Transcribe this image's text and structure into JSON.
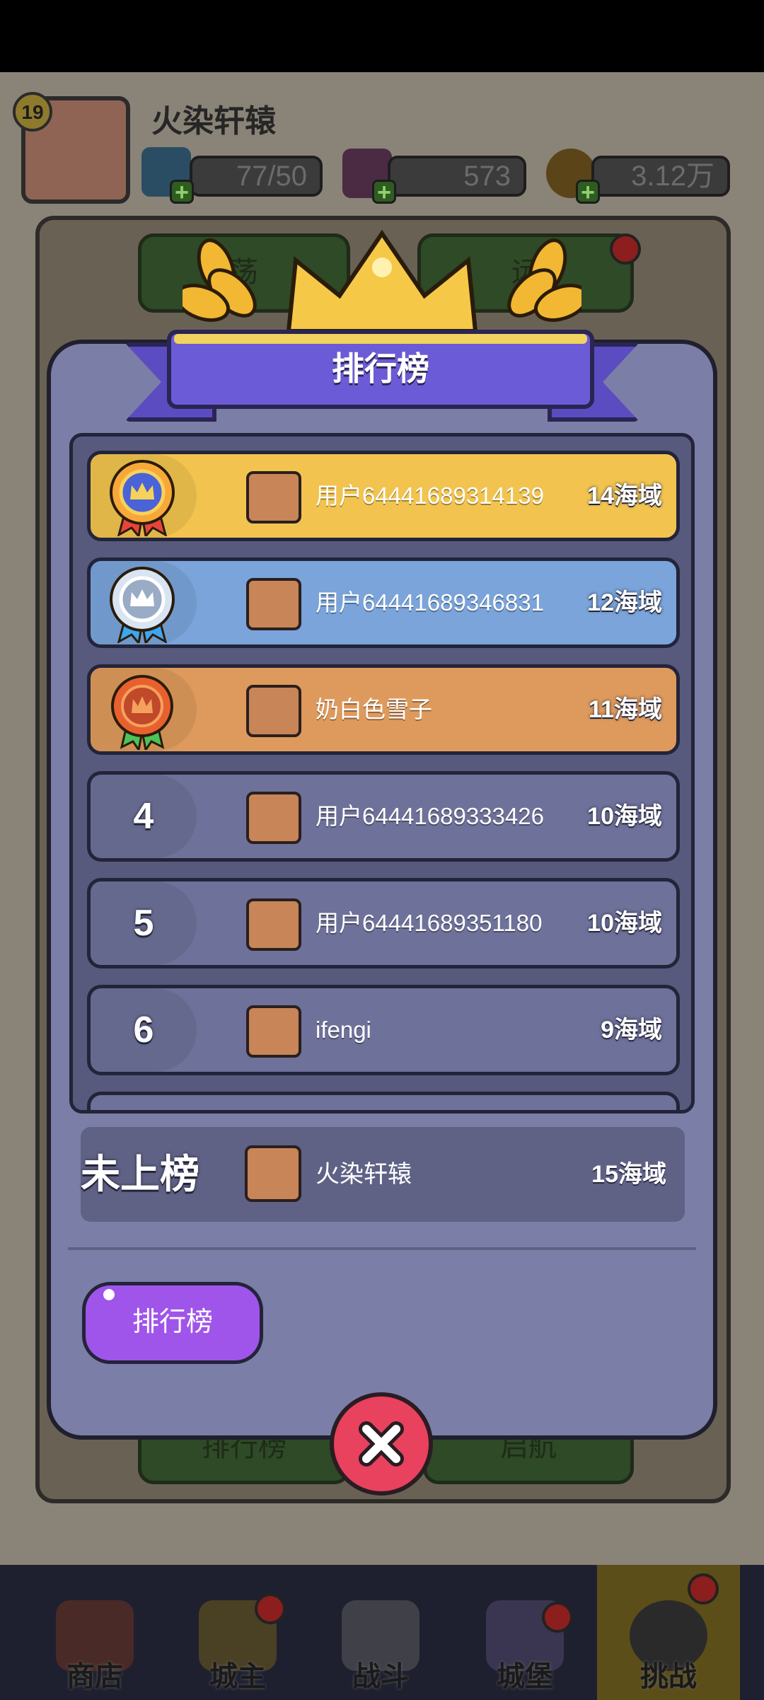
{
  "header": {
    "level": "19",
    "player_name": "火染轩辕",
    "energy": "77/50",
    "gems": "573",
    "coins": "3.12万"
  },
  "background_buttons": {
    "top_left": "荡",
    "top_right": "远",
    "bottom_left": "排行榜",
    "bottom_right": "启航"
  },
  "modal": {
    "title": "排行榜",
    "rows": [
      {
        "rank": "1",
        "name": "用户64441689314139",
        "score": "14海域",
        "color": "#f2c44f"
      },
      {
        "rank": "2",
        "name": "用户64441689346831",
        "score": "12海域",
        "color": "#7aa4da"
      },
      {
        "rank": "3",
        "name": "奶白色雪子",
        "score": "11海域",
        "color": "#de9a5c"
      },
      {
        "rank": "4",
        "name": "用户64441689333426",
        "score": "10海域",
        "color": "#6e7199"
      },
      {
        "rank": "5",
        "name": "用户64441689351180",
        "score": "10海域",
        "color": "#6e7199"
      },
      {
        "rank": "6",
        "name": "ifengi",
        "score": "9海域",
        "color": "#6e7199"
      }
    ],
    "self": {
      "rank": "未上榜",
      "name": "火染轩辕",
      "score": "15海域"
    },
    "leaderboard_button": "排行榜"
  },
  "nav": {
    "shop": "商店",
    "lord": "城主",
    "battle": "战斗",
    "castle": "城堡",
    "challenge": "挑战"
  }
}
